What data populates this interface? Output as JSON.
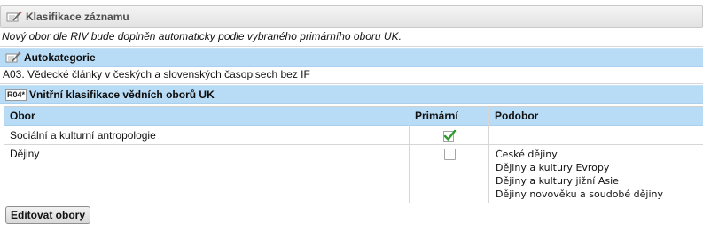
{
  "section": {
    "title": "Klasifikace záznamu",
    "icon": "edit-note-icon"
  },
  "note": "Nový obor dle RIV bude doplněn automaticky podle vybraného primárního oboru UK.",
  "autokategorie": {
    "title": "Autokategorie",
    "icon": "edit-note-icon",
    "value": "A03. Vědecké články v českých a slovenských časopisech bez IF"
  },
  "internal": {
    "badge": "R04*",
    "title": "Vnitřní klasifikace vědních oborů UK"
  },
  "table": {
    "headers": {
      "obor": "Obor",
      "primarni": "Primární",
      "podobor": "Podobor"
    },
    "rows": [
      {
        "obor": "Sociální a kulturní antropologie",
        "primarni": true,
        "podobory": []
      },
      {
        "obor": "Dějiny",
        "primarni": false,
        "podobory": [
          "České dějiny",
          "Dějiny a kultury Evropy",
          "Dějiny a kultury jižní Asie",
          "Dějiny novověku a soudobé dějiny"
        ]
      }
    ]
  },
  "edit_button": "Editovat obory",
  "colors": {
    "blue_header": "#b8dcf5",
    "check_green": "#2e9a2e"
  }
}
